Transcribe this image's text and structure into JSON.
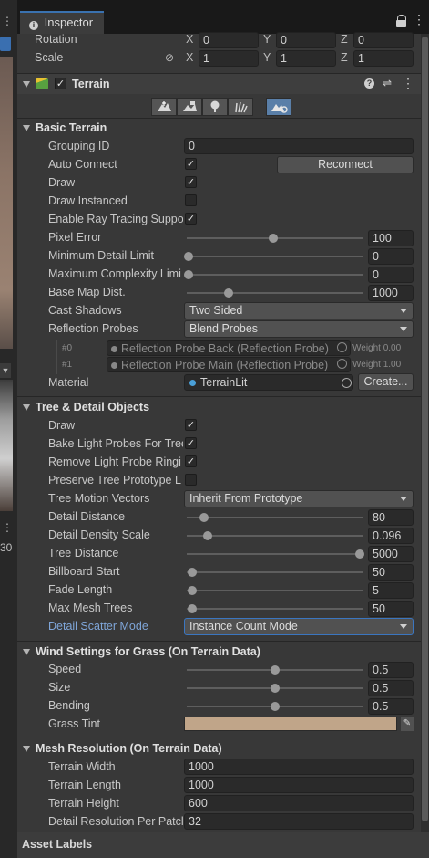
{
  "inspector": {
    "tab_title": "Inspector",
    "lock_icon": "lock-icon",
    "menu_icon": "kebab-menu-icon"
  },
  "left_strip": {
    "value_text": "30"
  },
  "transform": {
    "rotation_label": "Rotation",
    "scale_label": "Scale",
    "rotation": {
      "x": "0",
      "y": "0",
      "z": "0"
    },
    "scale": {
      "x": "1",
      "y": "1",
      "z": "1"
    },
    "axis_x": "X",
    "axis_y": "Y",
    "axis_z": "Z"
  },
  "component": {
    "title": "Terrain",
    "enabled": true
  },
  "toolbar_icons": [
    "raise-terrain-icon",
    "paint-terrain-icon",
    "paint-trees-icon",
    "paint-details-icon",
    "terrain-settings-icon"
  ],
  "basic": {
    "header": "Basic Terrain",
    "grouping_id_label": "Grouping ID",
    "grouping_id": "0",
    "auto_connect_label": "Auto Connect",
    "reconnect": "Reconnect",
    "draw_label": "Draw",
    "draw_instanced_label": "Draw Instanced",
    "ray_tracing_label": "Enable Ray Tracing Suppo",
    "pixel_error_label": "Pixel Error",
    "pixel_error": "100",
    "min_detail_label": "Minimum Detail Limit",
    "min_detail": "0",
    "max_complexity_label": "Maximum Complexity Limi",
    "max_complexity": "0",
    "base_map_label": "Base Map Dist.",
    "base_map": "1000",
    "cast_shadows_label": "Cast Shadows",
    "cast_shadows": "Two Sided",
    "reflection_label": "Reflection Probes",
    "reflection": "Blend Probes",
    "probe0_index": "#0",
    "probe0_name": "Reflection Probe Back (Reflection Probe)",
    "probe0_weight": "Weight 0.00",
    "probe1_index": "#1",
    "probe1_name": "Reflection Probe Main (Reflection Probe)",
    "probe1_weight": "Weight 1.00",
    "material_label": "Material",
    "material": "TerrainLit",
    "create": "Create..."
  },
  "tree": {
    "header": "Tree & Detail Objects",
    "draw_label": "Draw",
    "bake_label": "Bake Light Probes For Tree",
    "remove_label": "Remove Light Probe Ringi",
    "preserve_label": "Preserve Tree Prototype L",
    "motion_label": "Tree Motion Vectors",
    "motion": "Inherit From Prototype",
    "detail_distance_label": "Detail Distance",
    "detail_distance": "80",
    "density_label": "Detail Density Scale",
    "density": "0.096",
    "tree_distance_label": "Tree Distance",
    "tree_distance": "5000",
    "billboard_label": "Billboard Start",
    "billboard": "50",
    "fade_label": "Fade Length",
    "fade": "5",
    "max_mesh_label": "Max Mesh Trees",
    "max_mesh": "50",
    "scatter_label": "Detail Scatter Mode",
    "scatter": "Instance Count Mode"
  },
  "wind": {
    "header": "Wind Settings for Grass (On Terrain Data)",
    "speed_label": "Speed",
    "speed": "0.5",
    "size_label": "Size",
    "size": "0.5",
    "bending_label": "Bending",
    "bending": "0.5",
    "tint_label": "Grass Tint",
    "tint_color": "#c0a589"
  },
  "mesh": {
    "header": "Mesh Resolution (On Terrain Data)",
    "width_label": "Terrain Width",
    "width": "1000",
    "length_label": "Terrain Length",
    "length": "1000",
    "height_label": "Terrain Height",
    "height": "600",
    "detail_res_label": "Detail Resolution Per Patcl",
    "detail_res": "32"
  },
  "footer": {
    "asset_labels": "Asset Labels"
  },
  "sliders": {
    "pixel_error": 0.49,
    "min_detail": 0.0,
    "max_complexity": 0.0,
    "base_map": 0.24,
    "detail_distance": 0.1,
    "density": 0.12,
    "tree_distance": 1.0,
    "billboard": 0.03,
    "fade": 0.03,
    "max_mesh": 0.03,
    "speed": 0.5,
    "size": 0.5,
    "bending": 0.5
  }
}
